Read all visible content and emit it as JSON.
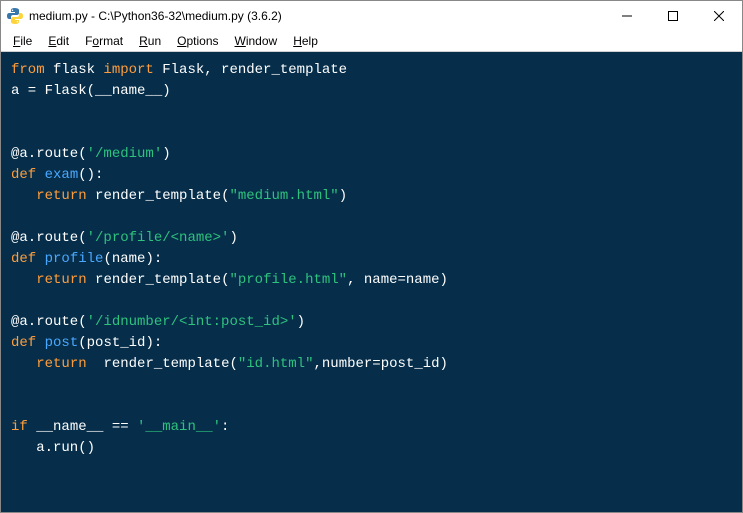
{
  "window": {
    "title": "medium.py - C:\\Python36-32\\medium.py (3.6.2)",
    "icon_name": "python-idle-icon"
  },
  "menu": {
    "items": [
      {
        "label": "File",
        "accel_index": 0
      },
      {
        "label": "Edit",
        "accel_index": 0
      },
      {
        "label": "Format",
        "accel_index": 1
      },
      {
        "label": "Run",
        "accel_index": 0
      },
      {
        "label": "Options",
        "accel_index": 0
      },
      {
        "label": "Window",
        "accel_index": 0
      },
      {
        "label": "Help",
        "accel_index": 0
      }
    ]
  },
  "code": {
    "lines": [
      {
        "type": "import",
        "kw1": "from",
        "mod": " flask ",
        "kw2": "import",
        "rest": " Flask, render_template"
      },
      {
        "type": "plain",
        "text": "a = Flask(__name__)"
      },
      {
        "type": "blank"
      },
      {
        "type": "blank"
      },
      {
        "type": "decorator",
        "prefix": "@a.route(",
        "str": "'/medium'",
        "suffix": ")"
      },
      {
        "type": "def",
        "kw": "def",
        "name": " exam",
        "params": "():"
      },
      {
        "type": "return_call",
        "indent": "   ",
        "kw": "return",
        "mid": " render_template(",
        "str": "\"medium.html\"",
        "suffix": ")"
      },
      {
        "type": "blank"
      },
      {
        "type": "decorator",
        "prefix": "@a.route(",
        "str": "'/profile/<name>'",
        "suffix": ")"
      },
      {
        "type": "def",
        "kw": "def",
        "name": " profile",
        "params": "(name):"
      },
      {
        "type": "return_call",
        "indent": "   ",
        "kw": "return",
        "mid": " render_template(",
        "str": "\"profile.html\"",
        "suffix": ", name=name)"
      },
      {
        "type": "blank"
      },
      {
        "type": "decorator",
        "prefix": "@a.route(",
        "str": "'/idnumber/<int:post_id>'",
        "suffix": ")"
      },
      {
        "type": "def",
        "kw": "def",
        "name": " post",
        "params": "(post_id):"
      },
      {
        "type": "return_call",
        "indent": "   ",
        "kw": "return",
        "mid": "  render_template(",
        "str": "\"id.html\"",
        "suffix": ",number=post_id)"
      },
      {
        "type": "blank"
      },
      {
        "type": "blank"
      },
      {
        "type": "if_main",
        "kw": "if",
        "mid": " __name__ == ",
        "str": "'__main__'",
        "suffix": ":"
      },
      {
        "type": "plain_indent",
        "indent": "   ",
        "text": "a.run()"
      }
    ]
  },
  "colors": {
    "editor_bg": "#062e4a",
    "keyword": "#ff9d3c",
    "defname": "#4aa8ff",
    "string": "#2ec27e",
    "text": "#ffffff"
  }
}
